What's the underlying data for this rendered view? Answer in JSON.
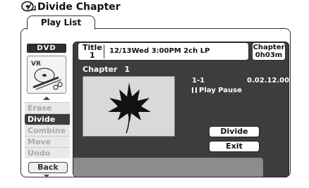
{
  "header": {
    "title": "Divide Chapter",
    "icon": "disc-edit-icon"
  },
  "tab": {
    "label": "Play List"
  },
  "left": {
    "media_label": "DVD",
    "disc_label": "VR",
    "menu": [
      {
        "label": "Erase",
        "active": false
      },
      {
        "label": "Divide",
        "active": true
      },
      {
        "label": "Combine",
        "active": false
      },
      {
        "label": "Move",
        "active": false
      },
      {
        "label": "Undo",
        "active": false
      }
    ],
    "back_label": "Back"
  },
  "title_bar": {
    "title_label": "Title",
    "title_number": "1",
    "info": "12/13Wed  3:00PM   2ch LP",
    "chapter_label": "Chapter",
    "chapter_length": "0h03m"
  },
  "chapter": {
    "label": "Chapter",
    "number": "1"
  },
  "playback": {
    "position": "1-1",
    "time": "0.02.12.00",
    "status": "Play Pause"
  },
  "buttons": {
    "divide": "Divide",
    "exit": "Exit"
  },
  "colors": {
    "panel": "#3d3d3d",
    "message_bar": "#8c8c8c",
    "thumbnail": "#d9d9d9"
  }
}
